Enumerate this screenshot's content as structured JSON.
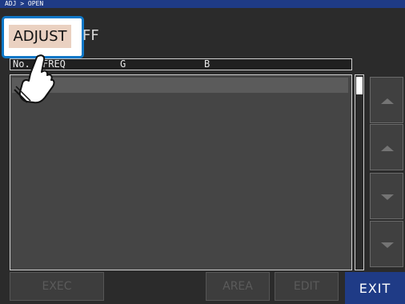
{
  "breadcrumb": "ADJ > OPEN",
  "status_text": "FF",
  "adjust_button_label": "ADJUST",
  "table": {
    "columns": [
      "No.",
      "FREQ",
      "G",
      "B"
    ]
  },
  "side_buttons": [
    {
      "icon": "triangle-up-icon"
    },
    {
      "icon": "triangle-up-icon"
    },
    {
      "icon": "triangle-down-icon"
    },
    {
      "icon": "triangle-down-icon"
    }
  ],
  "bottom_buttons": {
    "exec": "EXEC",
    "area": "AREA",
    "edit": "EDIT",
    "exit": "EXIT"
  },
  "colors": {
    "title_bar": "#1f3b86",
    "adjust_button": "#ead1c1",
    "highlight_border": "#0d78c8"
  }
}
